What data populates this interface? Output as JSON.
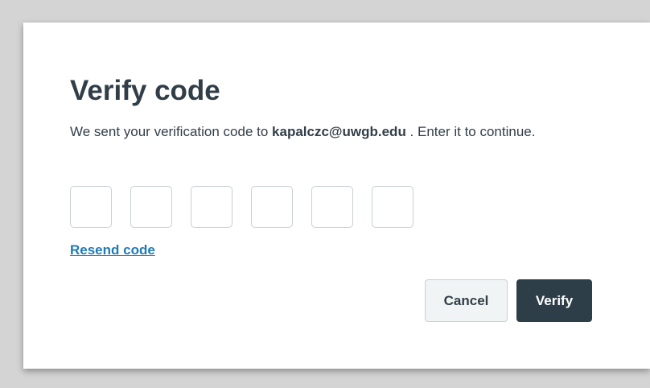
{
  "dialog": {
    "title": "Verify code",
    "message_prefix": "We sent your verification code to",
    "email": "kapalczc@uwgb.edu",
    "message_suffix": " . Enter it to continue.",
    "code_digits": [
      "",
      "",
      "",
      "",
      "",
      ""
    ],
    "resend_label": "Resend code",
    "cancel_label": "Cancel",
    "verify_label": "Verify"
  },
  "colors": {
    "backdrop": "#d4d4d4",
    "dialog_bg": "#ffffff",
    "text": "#313e48",
    "link": "#1f7bb6",
    "primary_button": "#2d3e48",
    "secondary_button": "#f1f4f5",
    "input_border": "#c9d0d5"
  }
}
